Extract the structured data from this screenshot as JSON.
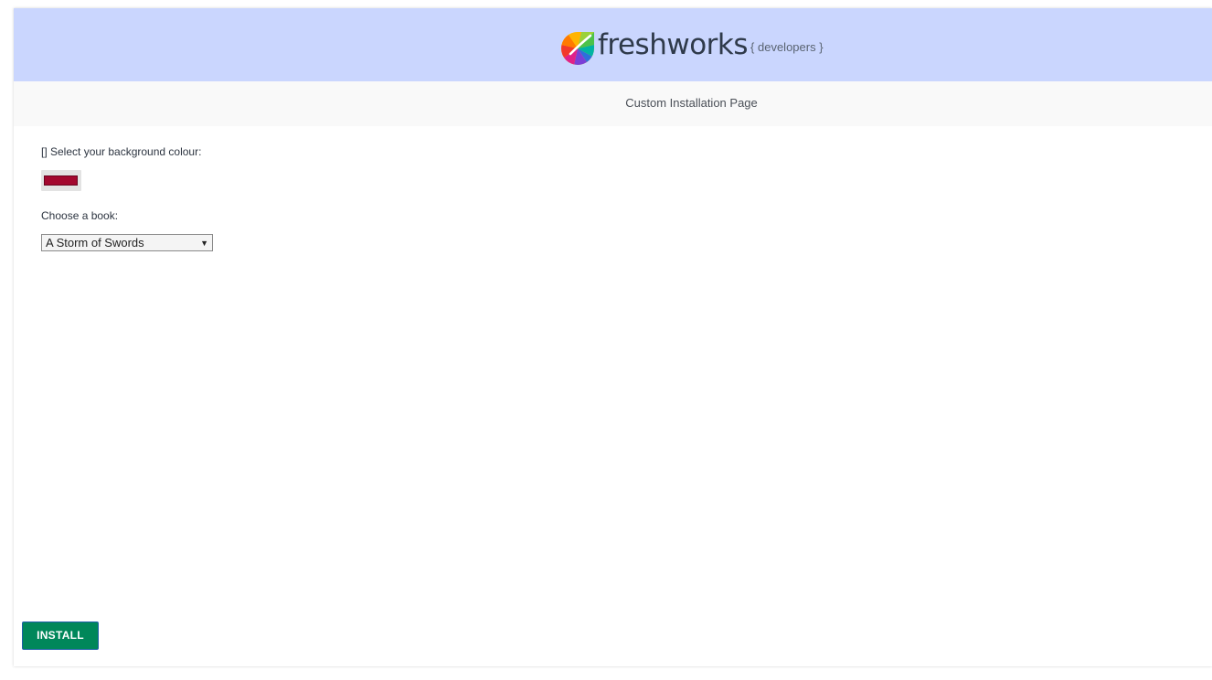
{
  "header": {
    "brand_name": "freshworks",
    "brand_suffix": "{ developers }",
    "logo_icon": "freshworks-leaf-icon"
  },
  "subheader": {
    "title": "Custom Installation Page"
  },
  "form": {
    "color_label": "[] Select your background colour:",
    "color_value": "#a3082f",
    "book_label": "Choose a book:",
    "book_selected": "A Storm of Swords",
    "book_arrow_icon": "dropdown-arrow-icon"
  },
  "footer": {
    "install_label": "INSTALL"
  },
  "colors": {
    "header_bg": "#cad6fe",
    "subheader_bg": "#f9f9f9",
    "install_bg": "#00875a",
    "swatch": "#a3082f"
  }
}
